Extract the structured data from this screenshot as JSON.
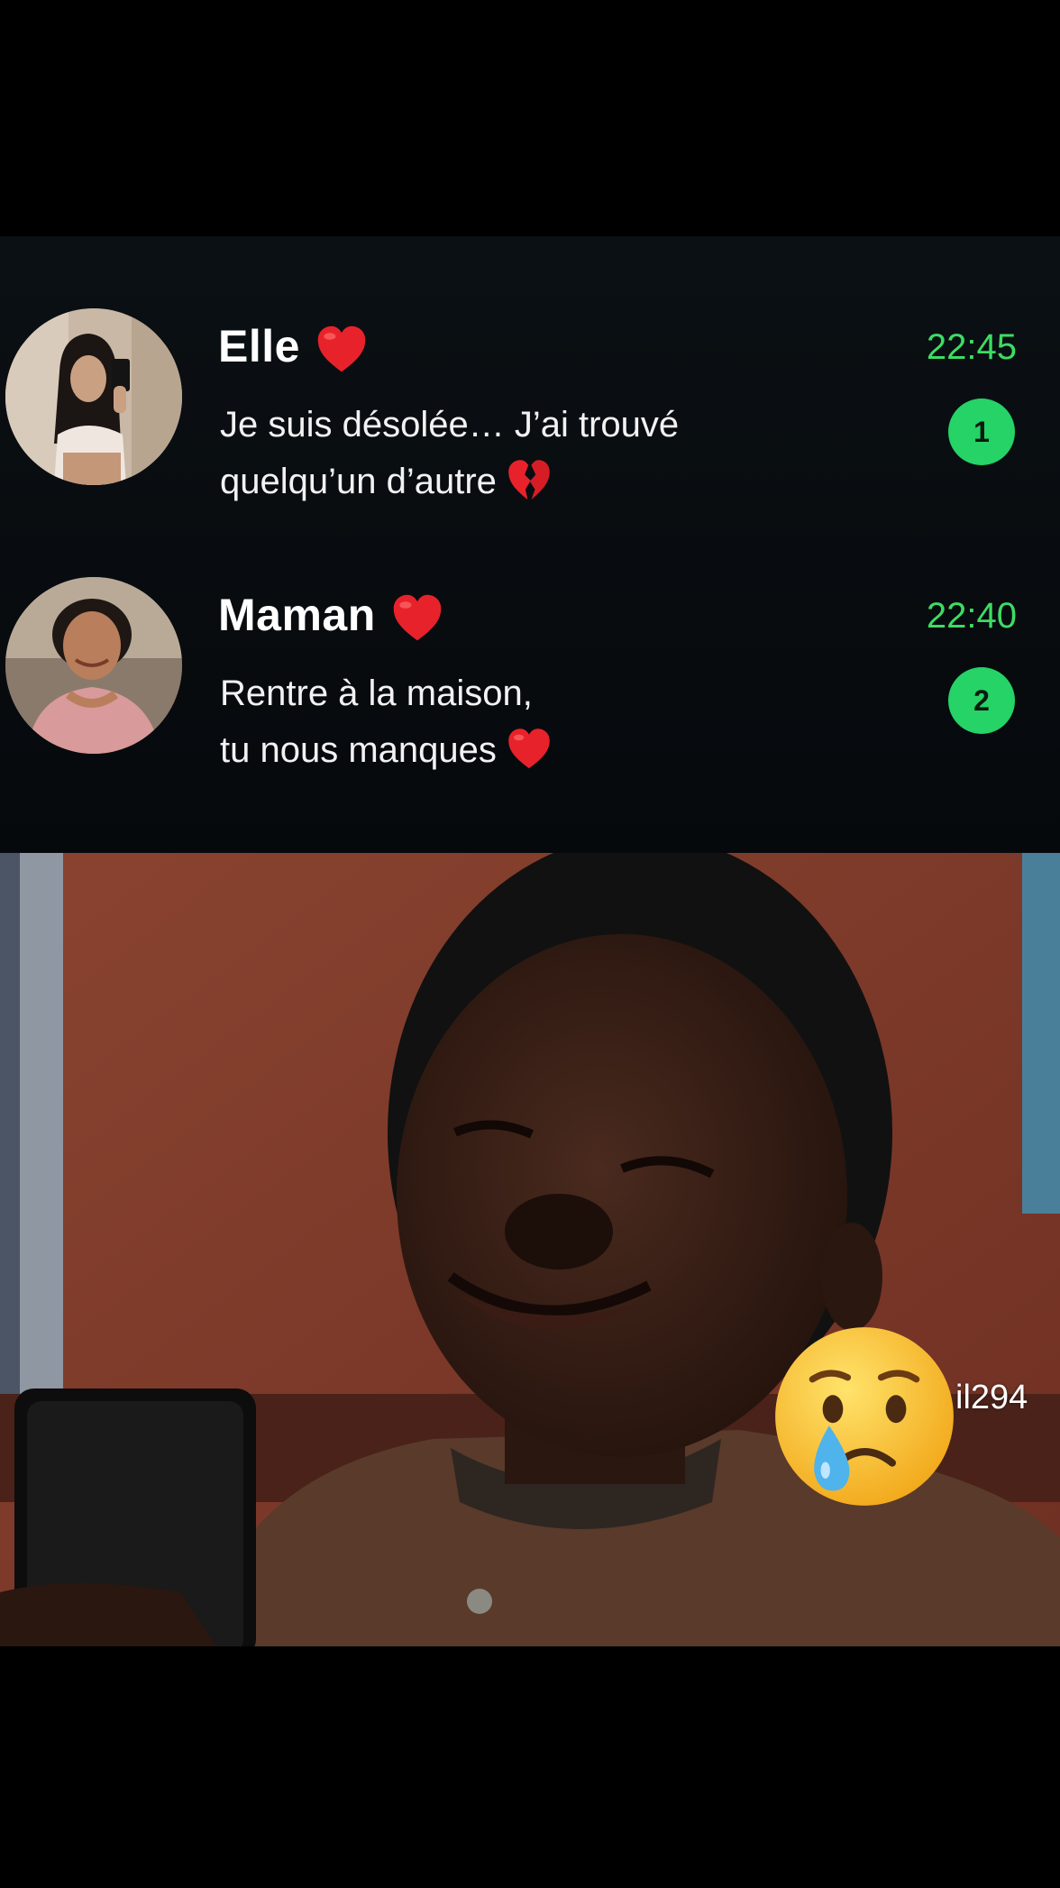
{
  "chats": [
    {
      "name": "Elle",
      "name_emoji": "red-heart-icon",
      "message_line1": "Je suis désolée… J’ai trouvé",
      "message_line2": "quelqu’un d’autre",
      "message_emoji": "broken-heart-icon",
      "time": "22:45",
      "unread": "1"
    },
    {
      "name": "Maman",
      "name_emoji": "red-heart-icon",
      "message_line1": "Rentre à la maison,",
      "message_line2": "tu nous manques",
      "message_emoji": "red-heart-icon",
      "time": "22:40",
      "unread": "2"
    }
  ],
  "photo": {
    "overlay_emoji": "crying-face-icon",
    "watermark": "il294"
  },
  "colors": {
    "time": "#3ddc63",
    "badge": "#25d366",
    "heart": "#e8222b"
  }
}
